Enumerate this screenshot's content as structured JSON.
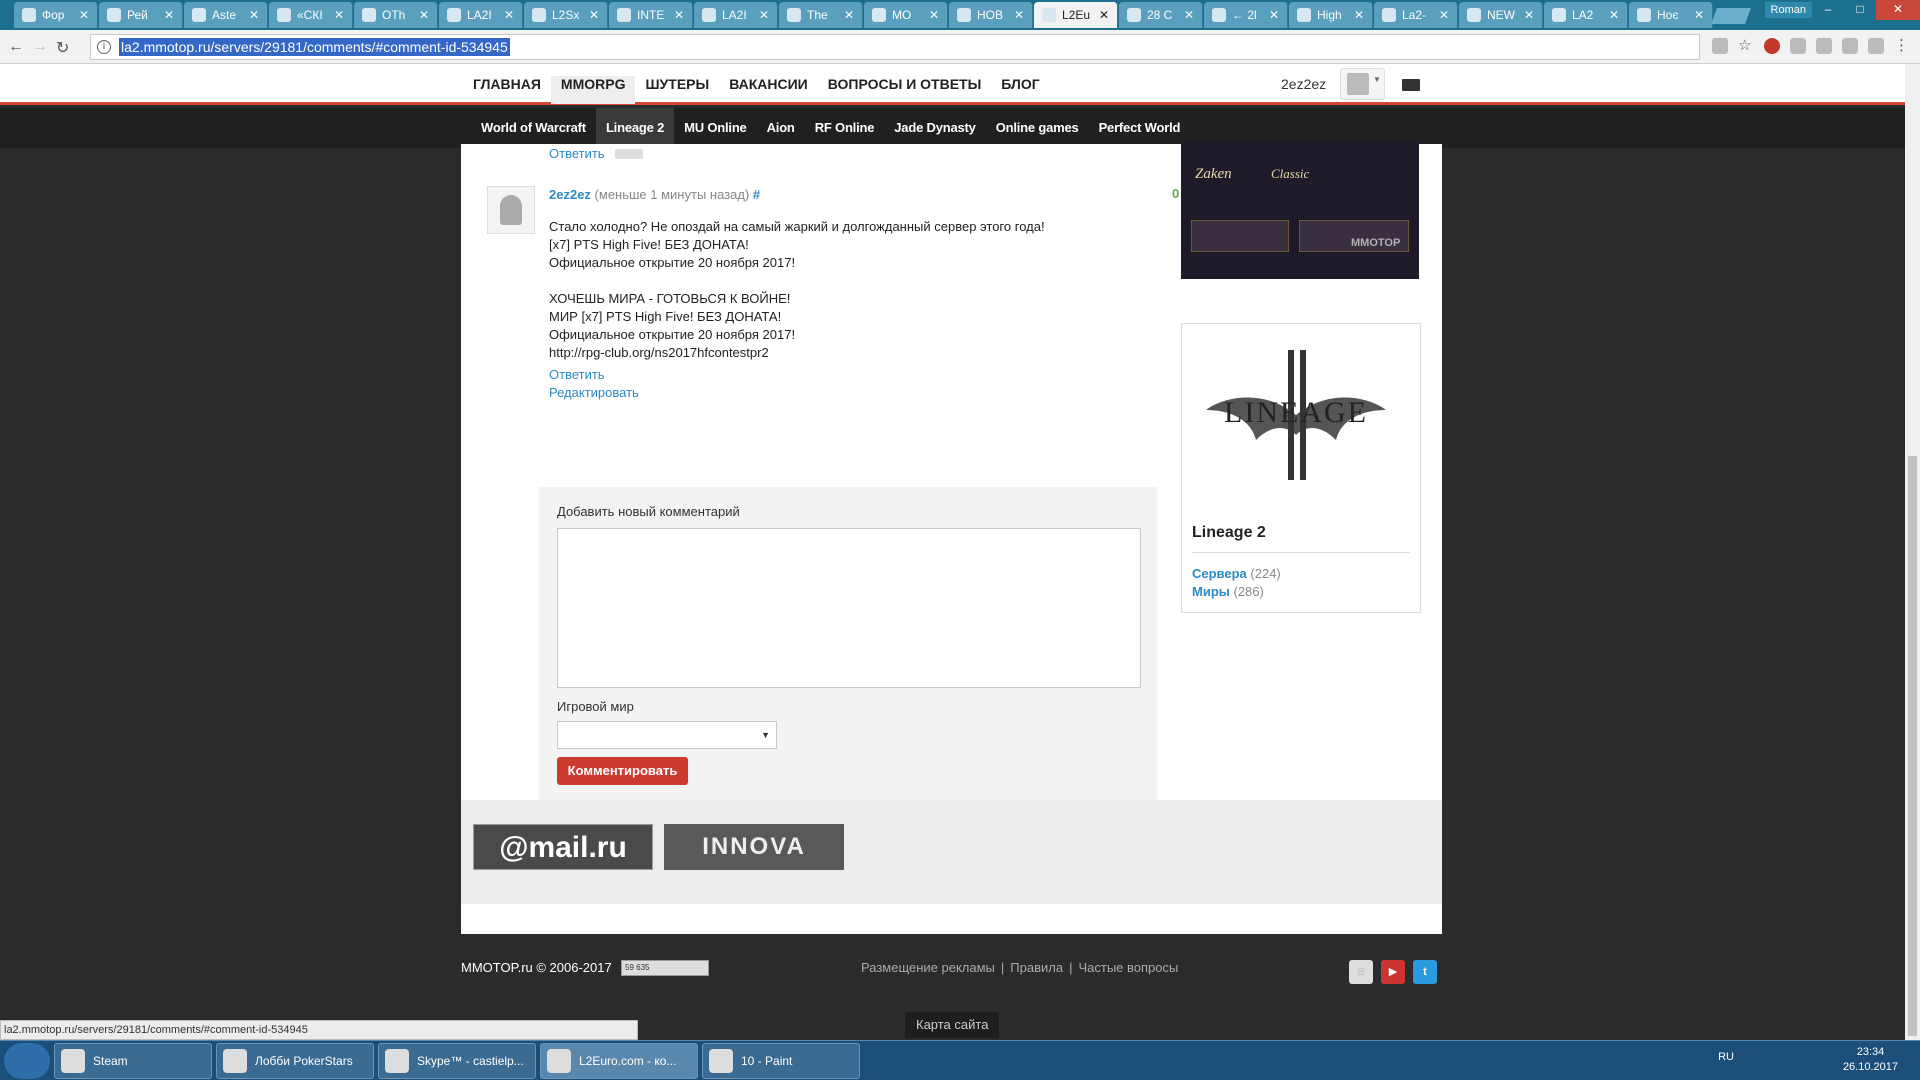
{
  "browser": {
    "tabs": [
      {
        "label": "Фор"
      },
      {
        "label": "Рей"
      },
      {
        "label": "Aste"
      },
      {
        "label": "«СКІ"
      },
      {
        "label": "ОТh"
      },
      {
        "label": "LA2I"
      },
      {
        "label": "L2Sx"
      },
      {
        "label": "INTE"
      },
      {
        "label": "LA2I"
      },
      {
        "label": "The"
      },
      {
        "label": "МО"
      },
      {
        "label": "НОВ"
      },
      {
        "label": "L2Eu"
      },
      {
        "label": "28 C"
      },
      {
        "label": "← 2l"
      },
      {
        "label": "High"
      },
      {
        "label": "La2-"
      },
      {
        "label": "NEW"
      },
      {
        "label": "LA2"
      },
      {
        "label": "Ноє"
      }
    ],
    "window_user": "Roman",
    "url": "la2.mmotop.ru/servers/29181/comments/#comment-id-534945",
    "status_url": "la2.mmotop.ru/servers/29181/comments/#comment-id-534945"
  },
  "topnav": {
    "items": [
      "ГЛАВНАЯ",
      "MMORPG",
      "ШУТЕРЫ",
      "ВАКАНСИИ",
      "ВОПРОСЫ И ОТВЕТЫ",
      "БЛОГ"
    ],
    "username": "2ez2ez"
  },
  "subnav": {
    "items": [
      "World of Warcraft",
      "Lineage 2",
      "MU Online",
      "Aion",
      "RF Online",
      "Jade Dynasty",
      "Online games",
      "Perfect World"
    ]
  },
  "prev_reply": "Ответить",
  "comment": {
    "author": "2ez2ez",
    "meta": "(меньше 1 минуты назад)",
    "hash": "#",
    "votes": "0",
    "text": "Стало холодно? Не опоздай на самый жаркий и долгожданный сервер этого года!\n[x7] PTS High Five! БЕЗ ДОНАТА!\nОфициальное открытие 20 ноября 2017!\n\nХОЧЕШЬ МИРА - ГОТОВЬСЯ К ВОЙНЕ!\nМИР [x7] PTS High Five! БЕЗ ДОНАТА!\nОфициальное открытие 20 ноября 2017!\nhttp://rpg-club.org/ns2017hfcontestpr2",
    "reply": "Ответить",
    "edit": "Редактировать"
  },
  "form": {
    "title": "Добавить новый комментарий",
    "world_label": "Игровой мир",
    "submit": "Комментировать"
  },
  "banner": {
    "text1": "Zaken",
    "text2": "Classic",
    "watermark": "MMOTOP"
  },
  "game_card": {
    "logo_text": "LINEAGE",
    "title": "Lineage 2",
    "servers_label": "Сервера",
    "servers_count": "(224)",
    "worlds_label": "Миры",
    "worlds_count": "(286)"
  },
  "partners": {
    "mail": "@mail.ru",
    "innova": "INNOVA"
  },
  "footer": {
    "copyright": "MMOTOP.ru © 2006-2017",
    "counter": "59 635",
    "links": [
      "Размещение рекламы",
      "Правила",
      "Частые вопросы"
    ],
    "sitemap": "Карта сайта"
  },
  "taskbar": {
    "items": [
      "Steam",
      "Лобби PokerStars",
      "Skype™ - castielp...",
      "L2Euro.com - ко...",
      "10 - Paint"
    ],
    "lang": "RU",
    "time": "23:34",
    "date": "26.10.2017"
  }
}
